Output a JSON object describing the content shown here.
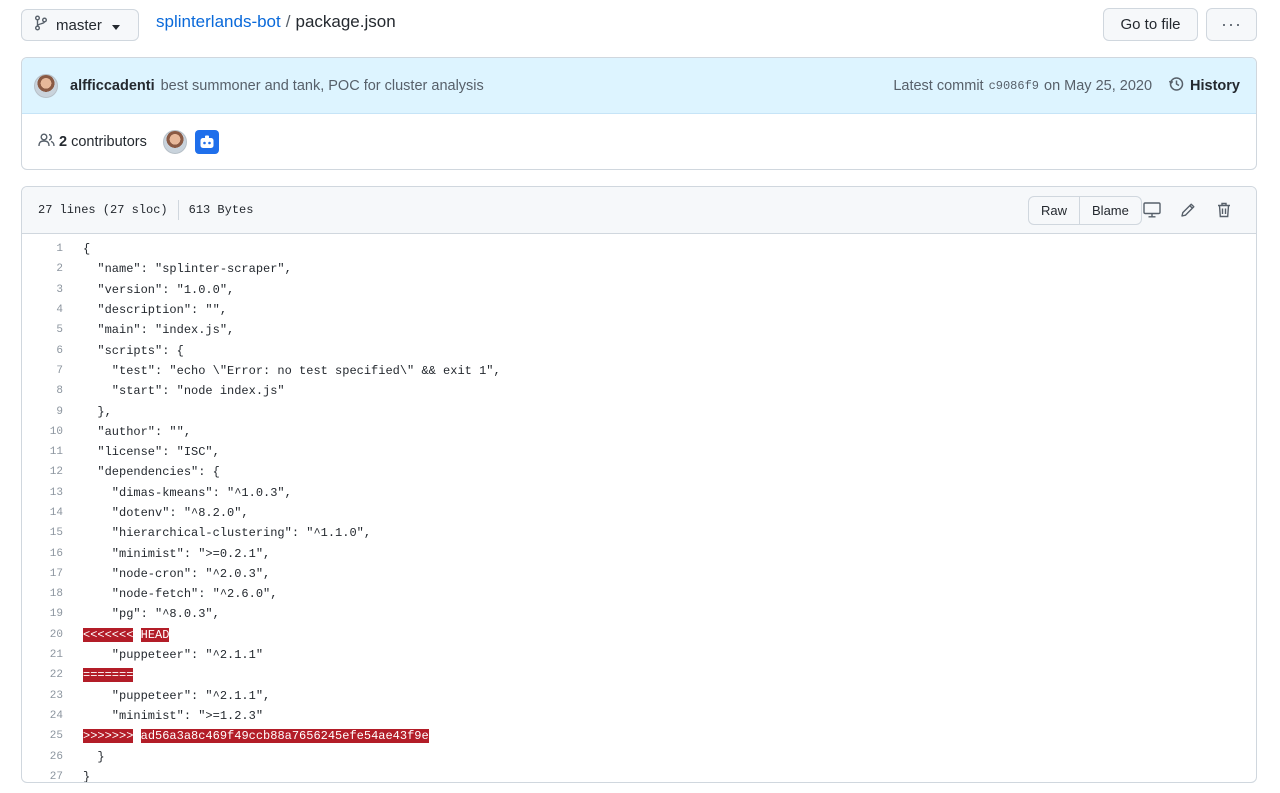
{
  "branch": {
    "name": "master"
  },
  "breadcrumb": {
    "repo": "splinterlands-bot",
    "separator": "/",
    "file": "package.json"
  },
  "actions": {
    "go_to_file": "Go to file",
    "more": "···"
  },
  "commit": {
    "author": "alfficcadenti",
    "message": "best summoner and tank, POC for cluster analysis",
    "latest_label": "Latest commit",
    "sha": "c9086f9",
    "date": "on May 25, 2020",
    "history_label": "History"
  },
  "contributors": {
    "count": "2",
    "label": "contributors"
  },
  "file": {
    "lines_info": "27 lines (27 sloc)",
    "size": "613 Bytes",
    "raw_label": "Raw",
    "blame_label": "Blame"
  },
  "code_lines": [
    {
      "n": "1",
      "text": "{"
    },
    {
      "n": "2",
      "text": "  \"name\": \"splinter-scraper\","
    },
    {
      "n": "3",
      "text": "  \"version\": \"1.0.0\","
    },
    {
      "n": "4",
      "text": "  \"description\": \"\","
    },
    {
      "n": "5",
      "text": "  \"main\": \"index.js\","
    },
    {
      "n": "6",
      "text": "  \"scripts\": {"
    },
    {
      "n": "7",
      "text": "    \"test\": \"echo \\\"Error: no test specified\\\" && exit 1\","
    },
    {
      "n": "8",
      "text": "    \"start\": \"node index.js\""
    },
    {
      "n": "9",
      "text": "  },"
    },
    {
      "n": "10",
      "text": "  \"author\": \"\","
    },
    {
      "n": "11",
      "text": "  \"license\": \"ISC\","
    },
    {
      "n": "12",
      "text": "  \"dependencies\": {"
    },
    {
      "n": "13",
      "text": "    \"dimas-kmeans\": \"^1.0.3\","
    },
    {
      "n": "14",
      "text": "    \"dotenv\": \"^8.2.0\","
    },
    {
      "n": "15",
      "text": "    \"hierarchical-clustering\": \"^1.1.0\","
    },
    {
      "n": "16",
      "text": "    \"minimist\": \">=0.2.1\","
    },
    {
      "n": "17",
      "text": "    \"node-cron\": \"^2.0.3\","
    },
    {
      "n": "18",
      "text": "    \"node-fetch\": \"^2.6.0\","
    },
    {
      "n": "19",
      "text": "    \"pg\": \"^8.0.3\","
    },
    {
      "n": "20",
      "text": "",
      "hl": [
        "<<<<<<<",
        " ",
        "HEAD"
      ]
    },
    {
      "n": "21",
      "text": "    \"puppeteer\": \"^2.1.1\""
    },
    {
      "n": "22",
      "text": "",
      "hl": [
        "======="
      ]
    },
    {
      "n": "23",
      "text": "    \"puppeteer\": \"^2.1.1\","
    },
    {
      "n": "24",
      "text": "    \"minimist\": \">=1.2.3\""
    },
    {
      "n": "25",
      "text": "",
      "hl": [
        ">>>>>>>",
        " ",
        "ad56a3a8c469f49ccb88a7656245efe54ae43f9e"
      ]
    },
    {
      "n": "26",
      "text": "  }"
    },
    {
      "n": "27",
      "text": "}"
    }
  ]
}
